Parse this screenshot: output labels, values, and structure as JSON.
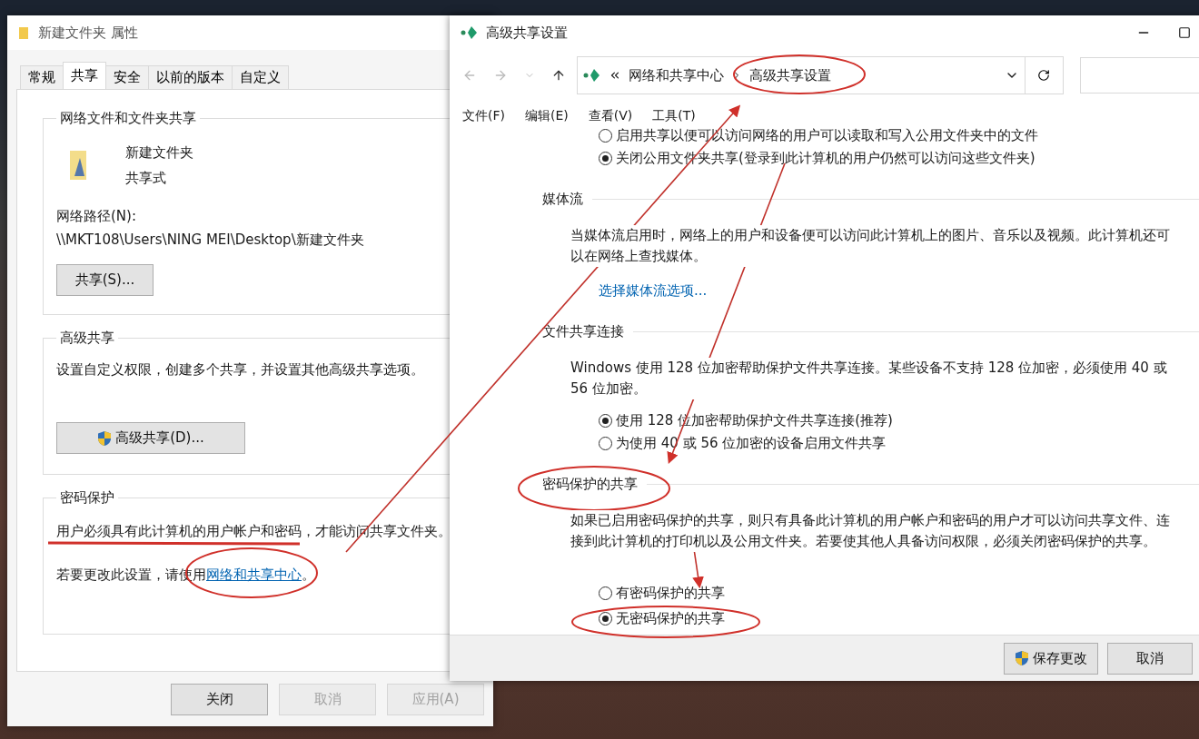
{
  "folder_properties": {
    "title": "新建文件夹 属性",
    "tabs": [
      {
        "label": "常规",
        "selected": false
      },
      {
        "label": "共享",
        "selected": true
      },
      {
        "label": "安全",
        "selected": false
      },
      {
        "label": "以前的版本",
        "selected": false
      },
      {
        "label": "自定义",
        "selected": false
      }
    ],
    "network_sharing": {
      "heading": "网络文件和文件夹共享",
      "name": "新建文件夹",
      "status": "共享式",
      "path_label": "网络路径(N):",
      "path": "\\\\MKT108\\Users\\NING MEI\\Desktop\\新建文件夹",
      "button": "共享(S)..."
    },
    "advanced_sharing": {
      "heading": "高级共享",
      "description": "设置自定义权限，创建多个共享，并设置其他高级共享选项。",
      "button": "高级共享(D)..."
    },
    "password_protection": {
      "heading": "密码保护",
      "description": "用户必须具有此计算机的用户帐户和密码，才能访问共享文件夹。",
      "hint": "若要更改此设置，请使用",
      "link": "网络和共享中心",
      "hint_end": "。"
    },
    "buttons": [
      {
        "label": "关闭",
        "disabled": false
      },
      {
        "label": "取消",
        "disabled": true
      },
      {
        "label": "应用(A)",
        "disabled": true
      }
    ]
  },
  "advanced_settings": {
    "title": "高级共享设置",
    "breadcrumb": [
      "网络和共享中心",
      "高级共享设置"
    ],
    "menu": [
      "文件(F)",
      "编辑(E)",
      "查看(V)",
      "工具(T)"
    ],
    "sections": [
      {
        "options": [
          {
            "label": "启用共享以便可以访问网络的用户可以读取和写入公用文件夹中的文件",
            "selected": false
          },
          {
            "label": "关闭公用文件夹共享(登录到此计算机的用户仍然可以访问这些文件夹)",
            "selected": true
          }
        ]
      },
      {
        "heading": "媒体流",
        "description": "当媒体流启用时，网络上的用户和设备便可以访问此计算机上的图片、音乐以及视频。此计算机还可以在网络上查找媒体。",
        "link": "选择媒体流选项..."
      },
      {
        "heading": "文件共享连接",
        "description": "Windows 使用 128 位加密帮助保护文件共享连接。某些设备不支持 128 位加密，必须使用 40 或 56 位加密。",
        "options": [
          {
            "label": "使用 128 位加密帮助保护文件共享连接(推荐)",
            "selected": true
          },
          {
            "label": "为使用 40 或 56 位加密的设备启用文件共享",
            "selected": false
          }
        ]
      },
      {
        "heading": "密码保护的共享",
        "description": "如果已启用密码保护的共享，则只有具备此计算机的用户帐户和密码的用户才可以访问共享文件、连接到此计算机的打印机以及公用文件夹。若要使其他人具备访问权限，必须关闭密码保护的共享。",
        "options": [
          {
            "label": "有密码保护的共享",
            "selected": false
          },
          {
            "label": "无密码保护的共享",
            "selected": true
          }
        ]
      }
    ],
    "buttons": [
      {
        "label": "保存更改",
        "shield": true
      },
      {
        "label": "取消",
        "shield": false
      }
    ]
  }
}
